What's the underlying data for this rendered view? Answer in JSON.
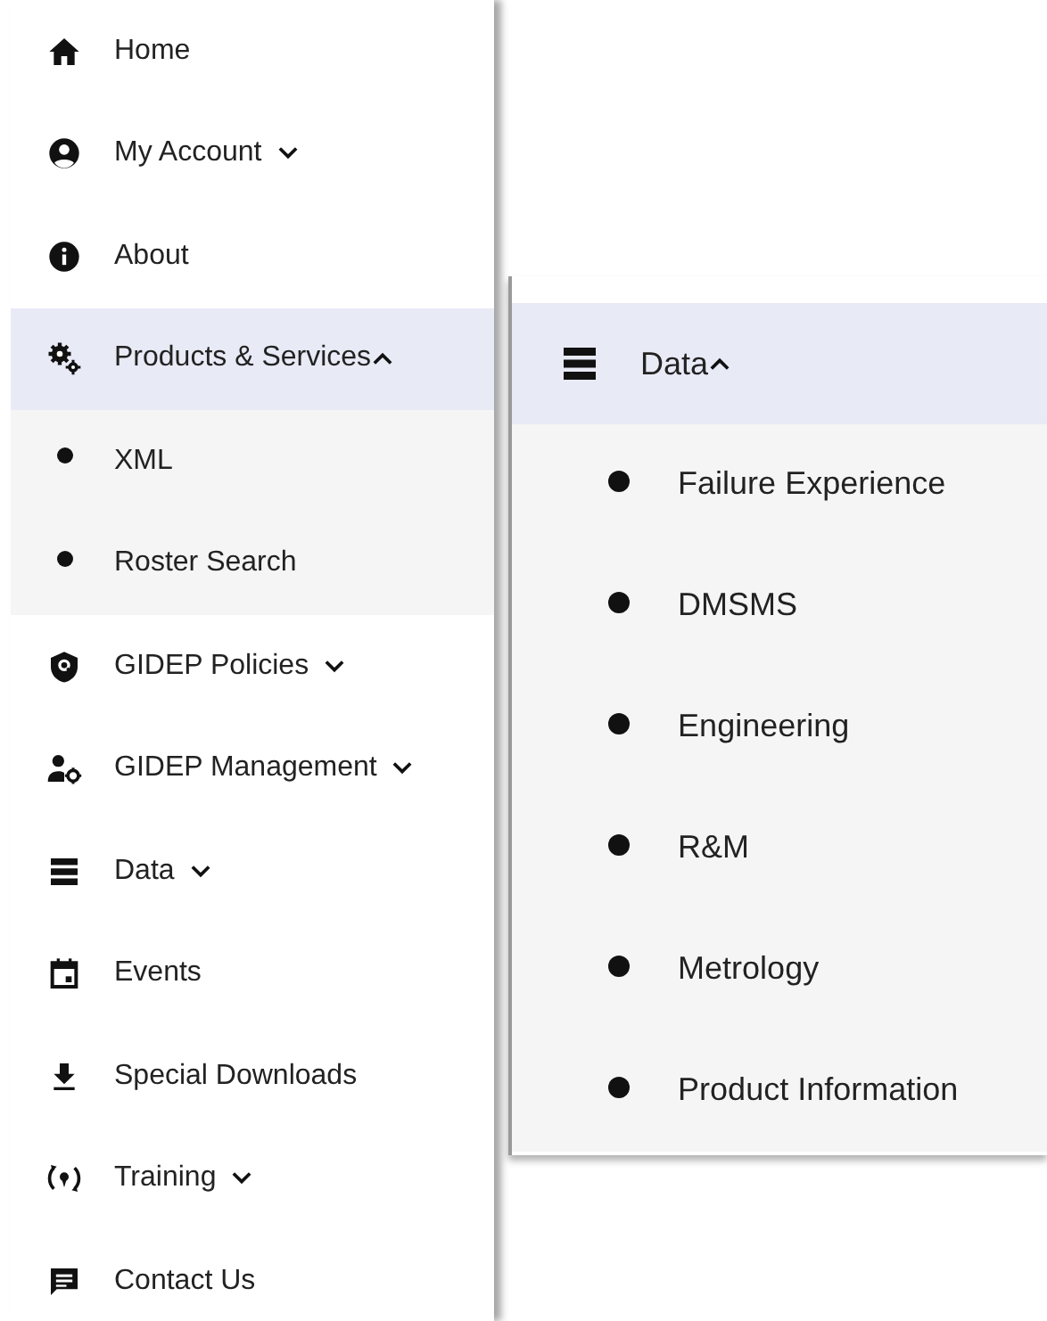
{
  "left_menu": {
    "items": [
      {
        "label": "Home",
        "kind": "link",
        "selected": false
      },
      {
        "label": "My Account",
        "kind": "group",
        "expanded": false,
        "selected": false
      },
      {
        "label": "About",
        "kind": "link",
        "selected": false
      },
      {
        "label": "Products & Services",
        "kind": "group",
        "expanded": true,
        "selected": true,
        "children": [
          {
            "label": "XML"
          },
          {
            "label": "Roster Search"
          }
        ]
      },
      {
        "label": "GIDEP Policies",
        "kind": "group",
        "expanded": false,
        "selected": false
      },
      {
        "label": "GIDEP Management",
        "kind": "group",
        "expanded": false,
        "selected": false
      },
      {
        "label": "Data",
        "kind": "group",
        "expanded": false,
        "selected": false
      },
      {
        "label": "Events",
        "kind": "link",
        "selected": false
      },
      {
        "label": "Special Downloads",
        "kind": "link",
        "selected": false
      },
      {
        "label": "Training",
        "kind": "group",
        "expanded": false,
        "selected": false
      },
      {
        "label": "Contact Us",
        "kind": "link",
        "selected": false
      }
    ]
  },
  "right_menu": {
    "items": [
      {
        "label": "Data",
        "kind": "group",
        "expanded": true,
        "selected": true,
        "children": [
          {
            "label": "Failure Experience"
          },
          {
            "label": "DMSMS"
          },
          {
            "label": "Engineering"
          },
          {
            "label": "R&M"
          },
          {
            "label": "Metrology"
          },
          {
            "label": "Product Information"
          }
        ]
      }
    ]
  }
}
